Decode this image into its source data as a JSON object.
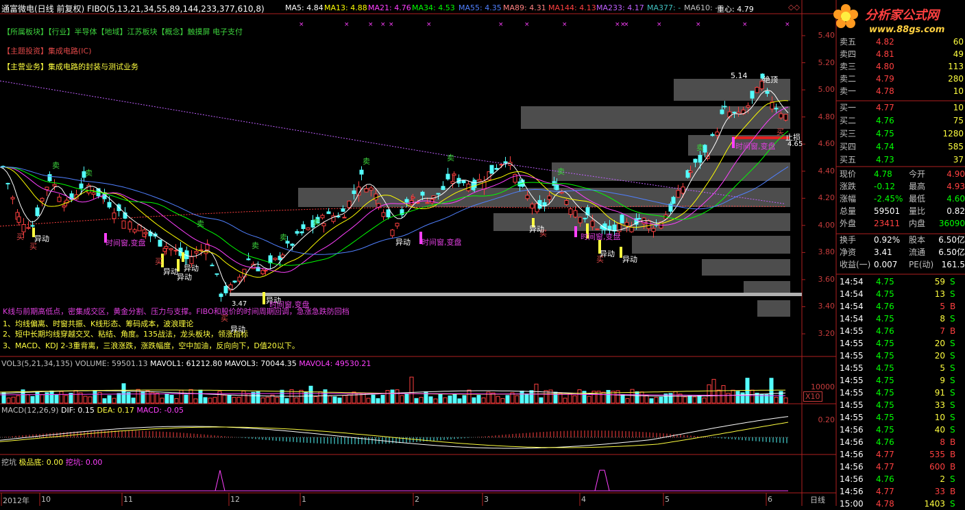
{
  "header": {
    "stock_name": "通富微电(日线 前复权)",
    "indicator": "FIBO(5,13,21,34,55,89,144,233,377,610,8)",
    "ma_items": [
      {
        "label": "MA5: 4.84",
        "color": "#ffffff"
      },
      {
        "label": "MA13: 4.88",
        "color": "#ffff00"
      },
      {
        "label": "MA21: 4.76",
        "color": "#ff40ff"
      },
      {
        "label": "MA34: 4.53",
        "color": "#00ff00"
      },
      {
        "label": "MA55: 4.35",
        "color": "#5080ff"
      },
      {
        "label": "MA89: 4.31",
        "color": "#ff8080"
      },
      {
        "label": "MA144: 4.13",
        "color": "#ff4040"
      },
      {
        "label": "MA233: 4.17",
        "color": "#c060ff"
      },
      {
        "label": "MA377: -",
        "color": "#40c0c0"
      },
      {
        "label": "MA610: -",
        "color": "#c0c0c0"
      },
      {
        "label": "重心: 4.79",
        "color": "#ffffff"
      }
    ]
  },
  "logo": {
    "text": "分析家公式网",
    "url": "www.88gs.com"
  },
  "info": {
    "sector": "【所属板块】【行业】半导体【地域】江苏板块【概念】触摸屏 电子支付",
    "theme": "【主题投资】集成电路(IC)",
    "business": "【主营业务】集成电路的封装与测试业务"
  },
  "notes": [
    "K线与前期高低点，密集成交区，黄金分割、压力与支撑。FIBO和股价的时间周期回调，急涨急跌防回档",
    "1、均线偏离、时窗共振、K线形态、筹码成本，波浪理论",
    "2、短中长期均线穿越交叉、粘结、角度。135战法，龙头板块，领涨指标",
    "3、MACD、KDJ 2-3重背离，三浪涨跌，涨跌幅度，空中加油，反向向下，D值20以下。"
  ],
  "price_axis": [
    "5.40",
    "5.20",
    "5.00",
    "4.80",
    "4.60",
    "4.40",
    "4.20",
    "4.00",
    "3.80",
    "3.60",
    "3.40",
    "3.20"
  ],
  "chart_labels": {
    "high_mark": "5.14",
    "top_label": "绝顶",
    "low_mark": "3.47",
    "stop_label": "止损",
    "stop_value": "4.65",
    "sell": "卖",
    "buy": "买",
    "move": "异动",
    "window": "时间窗,变盘",
    "big_window": "时间窗,变盘"
  },
  "volume": {
    "title": "VOL3(5,21,34,135)",
    "volume": "VOLUME: 59501.13",
    "mavol1": "MAVOL1: 61212.80",
    "mavol3": "MAVOL3: 70044.35",
    "mavol4": "MAVOL4: 49530.21",
    "axis": "10000",
    "unit": "X10"
  },
  "macd": {
    "title": "MACD(12,26,9)",
    "dif": "DIF: 0.15",
    "dea": "DEA: 0.17",
    "macd": "MACD: -0.05",
    "axis": "0.20"
  },
  "dig": {
    "title": "挖坑",
    "extreme": "极品底: 0.00",
    "pit": "挖坑: 0.00"
  },
  "dates": [
    "2012年",
    "10",
    "11",
    "12",
    "1",
    "2",
    "3",
    "4",
    "5",
    "6"
  ],
  "period": "日线",
  "order_book": {
    "asks": [
      {
        "label": "卖五",
        "price": "4.82",
        "vol": "60"
      },
      {
        "label": "卖四",
        "price": "4.81",
        "vol": "49"
      },
      {
        "label": "卖三",
        "price": "4.80",
        "vol": "113"
      },
      {
        "label": "卖二",
        "price": "4.79",
        "vol": "280"
      },
      {
        "label": "卖一",
        "price": "4.78",
        "vol": "10"
      }
    ],
    "bids": [
      {
        "label": "买一",
        "price": "4.77",
        "vol": "10"
      },
      {
        "label": "买二",
        "price": "4.76",
        "vol": "75"
      },
      {
        "label": "买三",
        "price": "4.75",
        "vol": "1280"
      },
      {
        "label": "买四",
        "price": "4.74",
        "vol": "585"
      },
      {
        "label": "买五",
        "price": "4.73",
        "vol": "37"
      }
    ]
  },
  "quote": [
    {
      "l1": "现价",
      "v1": "4.78",
      "c1": "#00ff00",
      "l2": "今开",
      "v2": "4.90",
      "c2": "#ff4040"
    },
    {
      "l1": "涨跌",
      "v1": "-0.12",
      "c1": "#00ff00",
      "l2": "最高",
      "v2": "4.93",
      "c2": "#ff4040"
    },
    {
      "l1": "涨幅",
      "v1": "-2.45%",
      "c1": "#00ff00",
      "l2": "最低",
      "v2": "4.60",
      "c2": "#00ff00"
    },
    {
      "l1": "总量",
      "v1": "59501",
      "c1": "#ffffff",
      "l2": "量比",
      "v2": "0.82",
      "c2": "#ffffff"
    },
    {
      "l1": "外盘",
      "v1": "23411",
      "c1": "#ff4040",
      "l2": "内盘",
      "v2": "36090",
      "c2": "#00ff00"
    },
    {
      "l1": "换手",
      "v1": "0.92%",
      "c1": "#ffffff",
      "l2": "股本",
      "v2": "6.50亿",
      "c2": "#ffffff"
    },
    {
      "l1": "净资",
      "v1": "3.41",
      "c1": "#ffffff",
      "l2": "流通",
      "v2": "6.50亿",
      "c2": "#ffffff"
    },
    {
      "l1": "收益(一)",
      "v1": "0.007",
      "c1": "#ffffff",
      "l2": "PE(动)",
      "v2": "161.5",
      "c2": "#ffffff"
    }
  ],
  "ticks": [
    {
      "t": "14:54",
      "p": "4.75",
      "v": "59",
      "s": "S"
    },
    {
      "t": "14:54",
      "p": "4.75",
      "v": "13",
      "s": "S"
    },
    {
      "t": "14:54",
      "p": "4.76",
      "v": "5",
      "s": "B"
    },
    {
      "t": "14:54",
      "p": "4.75",
      "v": "8",
      "s": "S"
    },
    {
      "t": "14:55",
      "p": "4.76",
      "v": "7",
      "s": "B"
    },
    {
      "t": "14:55",
      "p": "4.75",
      "v": "20",
      "s": "S"
    },
    {
      "t": "14:55",
      "p": "4.75",
      "v": "20",
      "s": "S"
    },
    {
      "t": "14:55",
      "p": "4.75",
      "v": "5",
      "s": "S"
    },
    {
      "t": "14:55",
      "p": "4.75",
      "v": "9",
      "s": "S"
    },
    {
      "t": "14:55",
      "p": "4.75",
      "v": "91",
      "s": "S"
    },
    {
      "t": "14:55",
      "p": "4.75",
      "v": "33",
      "s": "S"
    },
    {
      "t": "14:55",
      "p": "4.75",
      "v": "10",
      "s": "S"
    },
    {
      "t": "14:56",
      "p": "4.75",
      "v": "40",
      "s": "S"
    },
    {
      "t": "14:56",
      "p": "4.76",
      "v": "8",
      "s": "B"
    },
    {
      "t": "14:56",
      "p": "4.77",
      "v": "535",
      "s": "B"
    },
    {
      "t": "14:56",
      "p": "4.77",
      "v": "600",
      "s": "B"
    },
    {
      "t": "14:56",
      "p": "4.76",
      "v": "2",
      "s": "S"
    },
    {
      "t": "14:56",
      "p": "4.77",
      "v": "33",
      "s": "B"
    },
    {
      "t": "15:00",
      "p": "4.78",
      "v": "1403",
      "s": "S"
    }
  ],
  "chart_data": {
    "type": "candlestick",
    "y_range": [
      3.2,
      5.4
    ],
    "dates": [
      "2012年",
      "10",
      "11",
      "12",
      "1",
      "2",
      "3",
      "4",
      "5",
      "6"
    ],
    "high": 5.14,
    "low": 3.47,
    "close_last": 4.78,
    "stop_loss": 4.65
  }
}
